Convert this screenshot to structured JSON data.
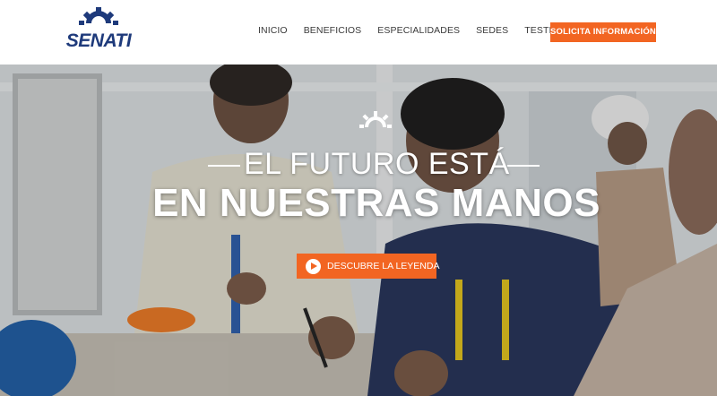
{
  "brand": {
    "name": "SENATI",
    "color": "#1e3a7b",
    "logo_icon": "gear-icon"
  },
  "nav": {
    "items": [
      {
        "label": "INICIO"
      },
      {
        "label": "BENEFICIOS"
      },
      {
        "label": "ESPECIALIDADES"
      },
      {
        "label": "SEDES"
      },
      {
        "label": "TESTIMONIOS"
      }
    ],
    "cta_label": "SOLICITA INFORMACIÓN"
  },
  "hero": {
    "tagline_line1": "EL FUTURO ESTÁ",
    "tagline_line2": "EN NUESTRAS MANOS",
    "button_label": "DESCUBRE LA LEYENDA",
    "button_icon": "play-icon",
    "mark_icon": "gear-icon"
  },
  "colors": {
    "accent": "#f26522",
    "brand": "#1e3a7b",
    "text_on_hero": "#ffffff"
  }
}
